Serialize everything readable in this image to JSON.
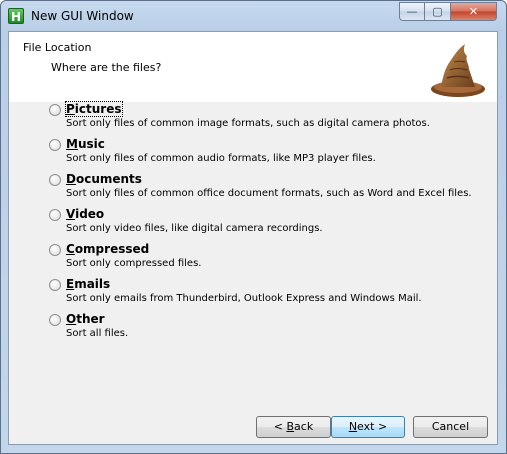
{
  "window": {
    "title": "New GUI Window",
    "app_icon_letter": "H",
    "min_glyph": "—",
    "max_glyph": "▢",
    "close_glyph": "✕"
  },
  "header": {
    "title": "File Location",
    "subtitle": "Where are the files?"
  },
  "options": [
    {
      "label_first": "P",
      "label_rest": "ictures",
      "description": "Sort only files of common image formats, such as digital camera photos."
    },
    {
      "label_first": "M",
      "label_rest": "usic",
      "description": "Sort only files of common audio formats, like MP3 player files."
    },
    {
      "label_first": "D",
      "label_rest": "ocuments",
      "description": "Sort only files of common office document formats, such as Word and Excel files."
    },
    {
      "label_first": "V",
      "label_rest": "ideo",
      "description": "Sort only video files, like digital camera recordings."
    },
    {
      "label_first": "C",
      "label_rest": "ompressed",
      "description": "Sort only compressed files."
    },
    {
      "label_first": "E",
      "label_rest": "mails",
      "description": "Sort only emails from Thunderbird, Outlook Express and Windows Mail."
    },
    {
      "label_first": "O",
      "label_rest": "ther",
      "description": "Sort all files."
    }
  ],
  "buttons": {
    "back_prefix": "< ",
    "back_mnemonic": "B",
    "back_rest": "ack",
    "next_mnemonic": "N",
    "next_rest": "ext >",
    "cancel": "Cancel"
  }
}
